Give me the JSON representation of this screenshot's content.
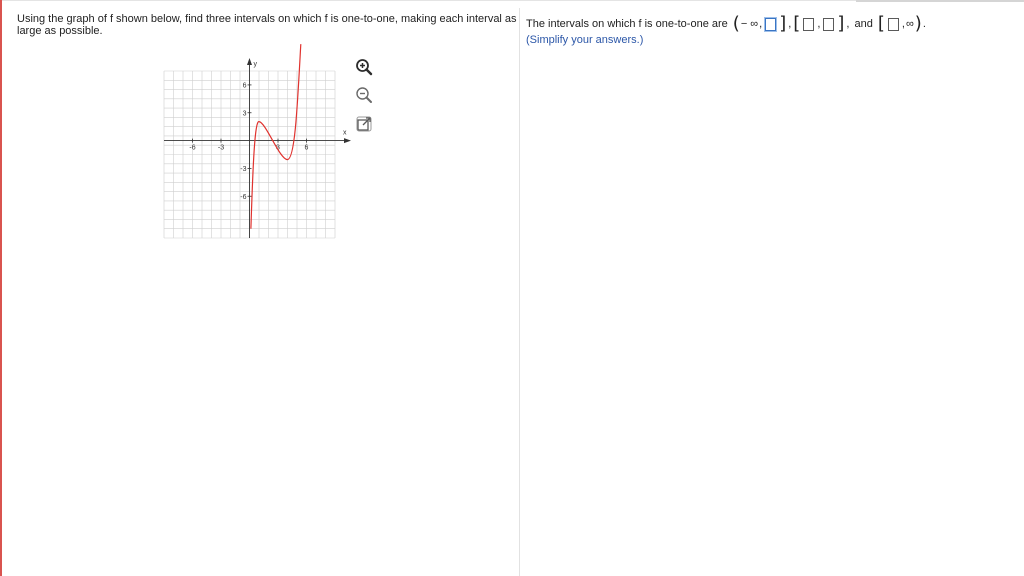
{
  "question": {
    "text": "Using the graph of f shown below, find three intervals on which f is one-to-one, making each interval as large as possible."
  },
  "graph": {
    "x_axis_label": "x",
    "y_axis_label": "y",
    "x_tick_labels": [
      "-6",
      "-3",
      "3",
      "6"
    ],
    "y_tick_labels": [
      "6",
      "3",
      "-3",
      "-6"
    ],
    "curve_color": "#e0322e",
    "grid_color": "#cfcfcf",
    "tools": {
      "zoom_in_icon": "magnifier-plus-icon",
      "zoom_out_icon": "magnifier-minus-icon",
      "popout_icon": "external-window-icon"
    }
  },
  "answer": {
    "lead": "The intervals on which f is one-to-one are",
    "open_paren": "(",
    "close_paren": ")",
    "neg_inf": "− ∞",
    "pos_inf": "∞",
    "comma": ",",
    "and": "and",
    "period": ".",
    "hint": "(Simplify your answers.)",
    "accent_color": "#3a75c4"
  }
}
